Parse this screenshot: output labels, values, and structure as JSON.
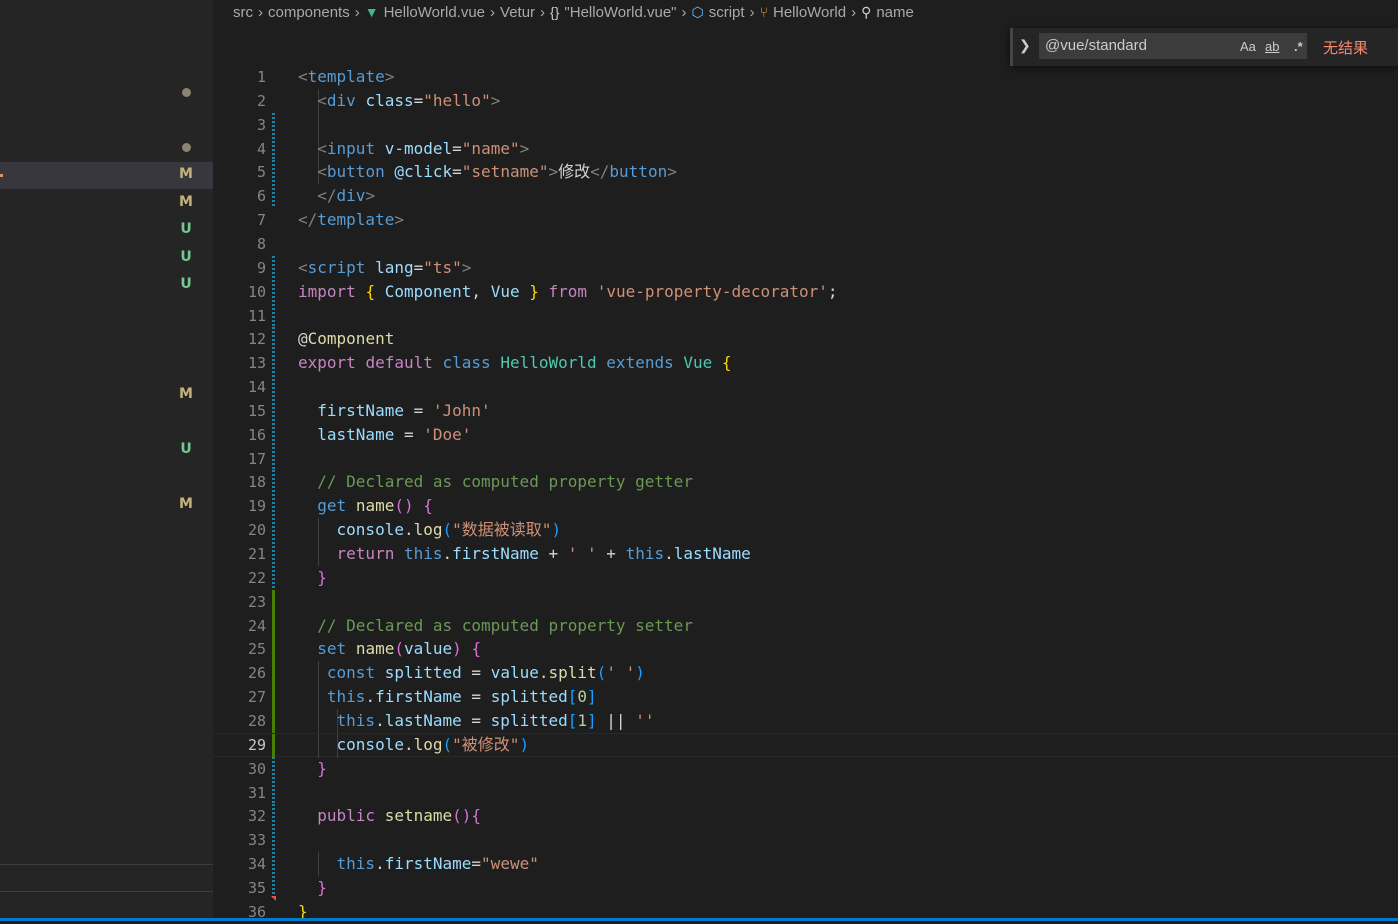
{
  "breadcrumb": {
    "items": [
      {
        "label": "src",
        "icon": ""
      },
      {
        "label": "components",
        "icon": ""
      },
      {
        "label": "HelloWorld.vue",
        "icon": "vue-icon"
      },
      {
        "label": "Vetur",
        "icon": ""
      },
      {
        "label": "\"HelloWorld.vue\"",
        "icon": "braces-icon"
      },
      {
        "label": "script",
        "icon": "cube-icon"
      },
      {
        "label": "HelloWorld",
        "icon": "class-icon"
      },
      {
        "label": "name",
        "icon": "wrench-icon"
      }
    ]
  },
  "find_widget": {
    "query": "@vue/standard",
    "match_case_label": "Aa",
    "whole_word_label": "ab",
    "regex_label": ".*",
    "result": "无结果"
  },
  "sidebar": {
    "badges": [
      {
        "type": "dot"
      },
      {
        "type": "dot"
      },
      {
        "type": "M"
      },
      {
        "type": "M"
      },
      {
        "type": "U"
      },
      {
        "type": "U"
      },
      {
        "type": "U"
      },
      {
        "type": "M"
      },
      {
        "type": "U"
      },
      {
        "type": "M"
      }
    ]
  },
  "editor": {
    "active_line": 29,
    "lines": [
      {
        "n": "1",
        "gutter": "",
        "tokens": [
          [
            "br",
            "<"
          ],
          [
            "tag",
            "template"
          ],
          [
            "br",
            ">"
          ]
        ]
      },
      {
        "n": "2",
        "gutter": "",
        "tokens": [
          [
            "p",
            "  "
          ],
          [
            "br",
            "<"
          ],
          [
            "tag",
            "div"
          ],
          [
            "p",
            " "
          ],
          [
            "attr",
            "class"
          ],
          [
            "p",
            "="
          ],
          [
            "str",
            "\"hello\""
          ],
          [
            "br",
            ">"
          ]
        ]
      },
      {
        "n": "3",
        "gutter": "mod",
        "tokens": []
      },
      {
        "n": "4",
        "gutter": "mod",
        "tokens": [
          [
            "p",
            "  "
          ],
          [
            "br",
            "<"
          ],
          [
            "tag",
            "input"
          ],
          [
            "p",
            " "
          ],
          [
            "attr",
            "v-model"
          ],
          [
            "p",
            "="
          ],
          [
            "str",
            "\"name\""
          ],
          [
            "br",
            ">"
          ]
        ]
      },
      {
        "n": "5",
        "gutter": "mod",
        "tokens": [
          [
            "p",
            "  "
          ],
          [
            "br",
            "<"
          ],
          [
            "tag",
            "button"
          ],
          [
            "p",
            " "
          ],
          [
            "attr",
            "@click"
          ],
          [
            "p",
            "="
          ],
          [
            "str",
            "\"setname\""
          ],
          [
            "br",
            ">"
          ],
          [
            "plain",
            "修改"
          ],
          [
            "br",
            "</"
          ],
          [
            "tag",
            "button"
          ],
          [
            "br",
            ">"
          ]
        ]
      },
      {
        "n": "6",
        "gutter": "mod",
        "tokens": [
          [
            "p",
            "  "
          ],
          [
            "br",
            "</"
          ],
          [
            "tag",
            "div"
          ],
          [
            "br",
            ">"
          ]
        ]
      },
      {
        "n": "7",
        "gutter": "",
        "tokens": [
          [
            "br",
            "</"
          ],
          [
            "tag",
            "template"
          ],
          [
            "br",
            ">"
          ]
        ]
      },
      {
        "n": "8",
        "gutter": "",
        "tokens": []
      },
      {
        "n": "9",
        "gutter": "mod",
        "tokens": [
          [
            "br",
            "<"
          ],
          [
            "tag",
            "script"
          ],
          [
            "p",
            " "
          ],
          [
            "attr",
            "lang"
          ],
          [
            "p",
            "="
          ],
          [
            "str",
            "\"ts\""
          ],
          [
            "br",
            ">"
          ]
        ]
      },
      {
        "n": "10",
        "gutter": "mod",
        "tokens": [
          [
            "kw",
            "import"
          ],
          [
            "p",
            " "
          ],
          [
            "b1",
            "{"
          ],
          [
            "p",
            " "
          ],
          [
            "var",
            "Component"
          ],
          [
            "p",
            ", "
          ],
          [
            "var",
            "Vue"
          ],
          [
            "p",
            " "
          ],
          [
            "b1",
            "}"
          ],
          [
            "p",
            " "
          ],
          [
            "kw",
            "from"
          ],
          [
            "p",
            " "
          ],
          [
            "str",
            "'vue-property-decorator'"
          ],
          [
            "p",
            ";"
          ]
        ]
      },
      {
        "n": "11",
        "gutter": "mod",
        "tokens": []
      },
      {
        "n": "12",
        "gutter": "mod",
        "tokens": [
          [
            "p",
            "@"
          ],
          [
            "dec",
            "Component"
          ]
        ]
      },
      {
        "n": "13",
        "gutter": "mod",
        "tokens": [
          [
            "kw",
            "export"
          ],
          [
            "p",
            " "
          ],
          [
            "kw",
            "default"
          ],
          [
            "p",
            " "
          ],
          [
            "st",
            "class"
          ],
          [
            "p",
            " "
          ],
          [
            "cls",
            "HelloWorld"
          ],
          [
            "p",
            " "
          ],
          [
            "st",
            "extends"
          ],
          [
            "p",
            " "
          ],
          [
            "cls",
            "Vue"
          ],
          [
            "p",
            " "
          ],
          [
            "b1",
            "{"
          ]
        ]
      },
      {
        "n": "14",
        "gutter": "mod",
        "tokens": []
      },
      {
        "n": "15",
        "gutter": "mod",
        "tokens": [
          [
            "p",
            "  "
          ],
          [
            "var",
            "firstName"
          ],
          [
            "p",
            " = "
          ],
          [
            "str",
            "'John'"
          ]
        ]
      },
      {
        "n": "16",
        "gutter": "mod",
        "tokens": [
          [
            "p",
            "  "
          ],
          [
            "var",
            "lastName"
          ],
          [
            "p",
            " = "
          ],
          [
            "str",
            "'Doe'"
          ]
        ]
      },
      {
        "n": "17",
        "gutter": "mod",
        "tokens": []
      },
      {
        "n": "18",
        "gutter": "mod",
        "tokens": [
          [
            "p",
            "  "
          ],
          [
            "cm",
            "// Declared as computed property getter"
          ]
        ]
      },
      {
        "n": "19",
        "gutter": "mod",
        "tokens": [
          [
            "p",
            "  "
          ],
          [
            "st",
            "get"
          ],
          [
            "p",
            " "
          ],
          [
            "fn",
            "name"
          ],
          [
            "b2",
            "()"
          ],
          [
            "p",
            " "
          ],
          [
            "b2",
            "{"
          ]
        ]
      },
      {
        "n": "20",
        "gutter": "mod",
        "tokens": [
          [
            "p",
            "    "
          ],
          [
            "var",
            "console"
          ],
          [
            "p",
            "."
          ],
          [
            "fn",
            "log"
          ],
          [
            "b3",
            "("
          ],
          [
            "str",
            "\"数据被读取\""
          ],
          [
            "b3",
            ")"
          ]
        ]
      },
      {
        "n": "21",
        "gutter": "mod",
        "tokens": [
          [
            "p",
            "    "
          ],
          [
            "kw",
            "return"
          ],
          [
            "p",
            " "
          ],
          [
            "st",
            "this"
          ],
          [
            "p",
            "."
          ],
          [
            "var",
            "firstName"
          ],
          [
            "p",
            " + "
          ],
          [
            "str",
            "' '"
          ],
          [
            "p",
            " + "
          ],
          [
            "st",
            "this"
          ],
          [
            "p",
            "."
          ],
          [
            "var",
            "lastName"
          ]
        ]
      },
      {
        "n": "22",
        "gutter": "mod",
        "tokens": [
          [
            "p",
            "  "
          ],
          [
            "b2",
            "}"
          ]
        ]
      },
      {
        "n": "23",
        "gutter": "add",
        "tokens": []
      },
      {
        "n": "24",
        "gutter": "add",
        "tokens": [
          [
            "p",
            "  "
          ],
          [
            "cm",
            "// Declared as computed property setter"
          ]
        ]
      },
      {
        "n": "25",
        "gutter": "add",
        "tokens": [
          [
            "p",
            "  "
          ],
          [
            "st",
            "set"
          ],
          [
            "p",
            " "
          ],
          [
            "fn",
            "name"
          ],
          [
            "b2",
            "("
          ],
          [
            "var",
            "value"
          ],
          [
            "b2",
            ")"
          ],
          [
            "p",
            " "
          ],
          [
            "b2",
            "{"
          ]
        ]
      },
      {
        "n": "26",
        "gutter": "add",
        "tokens": [
          [
            "p",
            "   "
          ],
          [
            "st",
            "const"
          ],
          [
            "p",
            " "
          ],
          [
            "var",
            "splitted"
          ],
          [
            "p",
            " = "
          ],
          [
            "var",
            "value"
          ],
          [
            "p",
            "."
          ],
          [
            "fn",
            "split"
          ],
          [
            "b3",
            "("
          ],
          [
            "str",
            "' '"
          ],
          [
            "b3",
            ")"
          ]
        ]
      },
      {
        "n": "27",
        "gutter": "add",
        "tokens": [
          [
            "p",
            "   "
          ],
          [
            "st",
            "this"
          ],
          [
            "p",
            "."
          ],
          [
            "var",
            "firstName"
          ],
          [
            "p",
            " = "
          ],
          [
            "var",
            "splitted"
          ],
          [
            "b3",
            "["
          ],
          [
            "num",
            "0"
          ],
          [
            "b3",
            "]"
          ]
        ]
      },
      {
        "n": "28",
        "gutter": "add",
        "tokens": [
          [
            "p",
            "    "
          ],
          [
            "st",
            "this"
          ],
          [
            "p",
            "."
          ],
          [
            "var",
            "lastName"
          ],
          [
            "p",
            " = "
          ],
          [
            "var",
            "splitted"
          ],
          [
            "b3",
            "["
          ],
          [
            "num",
            "1"
          ],
          [
            "b3",
            "]"
          ],
          [
            "p",
            " || "
          ],
          [
            "str",
            "''"
          ]
        ]
      },
      {
        "n": "29",
        "gutter": "add",
        "tokens": [
          [
            "p",
            "    "
          ],
          [
            "var",
            "console"
          ],
          [
            "p",
            "."
          ],
          [
            "fn",
            "log"
          ],
          [
            "b3",
            "("
          ],
          [
            "str",
            "\"被修改\""
          ],
          [
            "b3",
            ")"
          ]
        ]
      },
      {
        "n": "30",
        "gutter": "mod",
        "tokens": [
          [
            "p",
            "  "
          ],
          [
            "b2",
            "}"
          ]
        ]
      },
      {
        "n": "31",
        "gutter": "mod",
        "tokens": []
      },
      {
        "n": "32",
        "gutter": "mod",
        "tokens": [
          [
            "p",
            "  "
          ],
          [
            "kw",
            "public"
          ],
          [
            "p",
            " "
          ],
          [
            "fn",
            "setname"
          ],
          [
            "b2",
            "(){"
          ]
        ]
      },
      {
        "n": "33",
        "gutter": "mod",
        "tokens": []
      },
      {
        "n": "34",
        "gutter": "mod",
        "tokens": [
          [
            "p",
            "    "
          ],
          [
            "st",
            "this"
          ],
          [
            "p",
            "."
          ],
          [
            "var",
            "firstName"
          ],
          [
            "p",
            "="
          ],
          [
            "str",
            "\"wewe\""
          ]
        ]
      },
      {
        "n": "35",
        "gutter": "mod",
        "tokens": [
          [
            "p",
            "  "
          ],
          [
            "b2",
            "}"
          ]
        ]
      },
      {
        "n": "36",
        "gutter": "",
        "tokens": [
          [
            "b1",
            "}"
          ]
        ]
      }
    ]
  }
}
